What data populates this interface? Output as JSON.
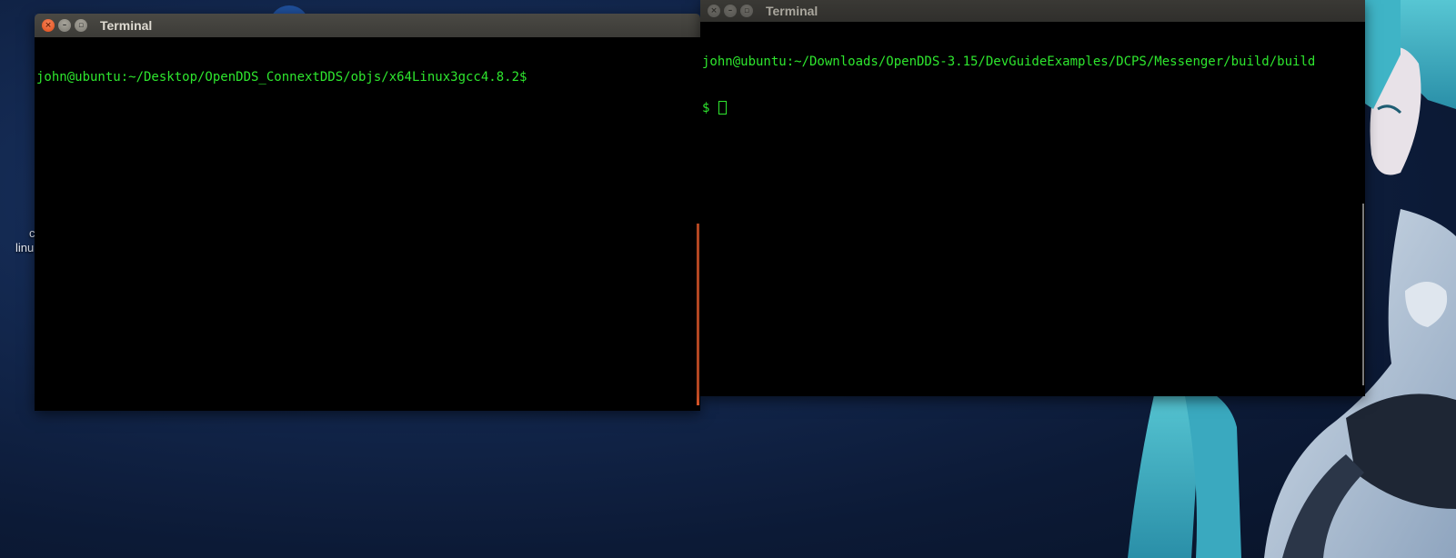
{
  "desktop": {
    "icon_label_line1": "c",
    "icon_label_line2": "linu"
  },
  "windows": [
    {
      "title": "Terminal",
      "state": "active",
      "lines": [
        "john@ubuntu:~/Desktop/OpenDDS_ConnextDDS/objs/x64Linux3gcc4.8.2$"
      ]
    },
    {
      "title": "Terminal",
      "state": "inactive",
      "lines": [
        "john@ubuntu:~/Downloads/OpenDDS-3.15/DevGuideExamples/DCPS/Messenger/build/build",
        "$ "
      ]
    }
  ],
  "buttons": {
    "close_glyph": "×",
    "minimize_glyph": "–",
    "maximize_glyph": "▫"
  },
  "colors": {
    "terminal_text": "#2ee62e",
    "close_button": "#df4a16",
    "scrollbar_accent": "#e0582a"
  }
}
